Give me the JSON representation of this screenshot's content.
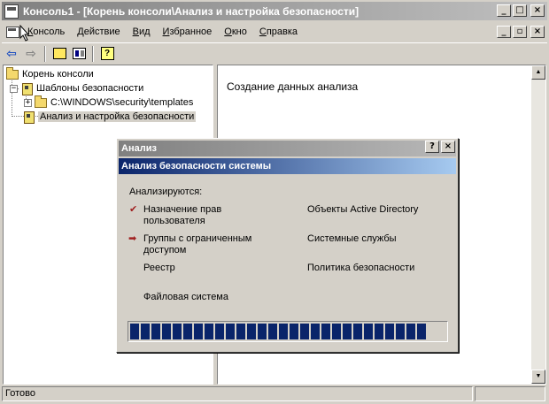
{
  "window": {
    "title": "Консоль1 - [Корень консоли\\Анализ и настройка безопасности]",
    "controls": {
      "minimize": "_",
      "maximize": "□",
      "close": "×"
    }
  },
  "menu": {
    "items": [
      {
        "underline": "К",
        "rest": "онсоль"
      },
      {
        "underline": "Д",
        "rest": "ействие"
      },
      {
        "underline": "В",
        "rest": "ид"
      },
      {
        "underline": "И",
        "rest": "збранное"
      },
      {
        "underline": "О",
        "rest": "кно"
      },
      {
        "underline": "С",
        "rest": "правка"
      }
    ],
    "controls": {
      "minimize": "_",
      "restore": "▫",
      "close": "×"
    }
  },
  "toolbar": {
    "back": "⇦",
    "forward": "⇨",
    "help": "?"
  },
  "tree": {
    "root": "Корень консоли",
    "templates": "Шаблоны безопасности",
    "templates_path": "C:\\WINDOWS\\security\\templates",
    "analysis": "Анализ и настройка безопасности",
    "expander": "+"
  },
  "right_pane": {
    "message": "Создание данных анализа",
    "scroll_up": "▲",
    "scroll_down": "▼"
  },
  "status": {
    "text": "Готово"
  },
  "dialog": {
    "title": "Анализ",
    "help_btn": "?",
    "close_btn": "×",
    "header": "Анализ безопасности системы",
    "intro": "Анализируются:",
    "items": {
      "user_rights": "Назначение прав\nпользователя",
      "restricted_groups": "Группы с ограниченным\nдоступом",
      "registry": "Реестр",
      "file_system": "Файловая система",
      "active_directory": "Объекты Active Directory",
      "system_services": "Системные службы",
      "security_policy": "Политика безопасности"
    },
    "done_mark": "✔",
    "current_mark": "➡",
    "progress": {
      "filled_fraction": 0.97
    }
  }
}
